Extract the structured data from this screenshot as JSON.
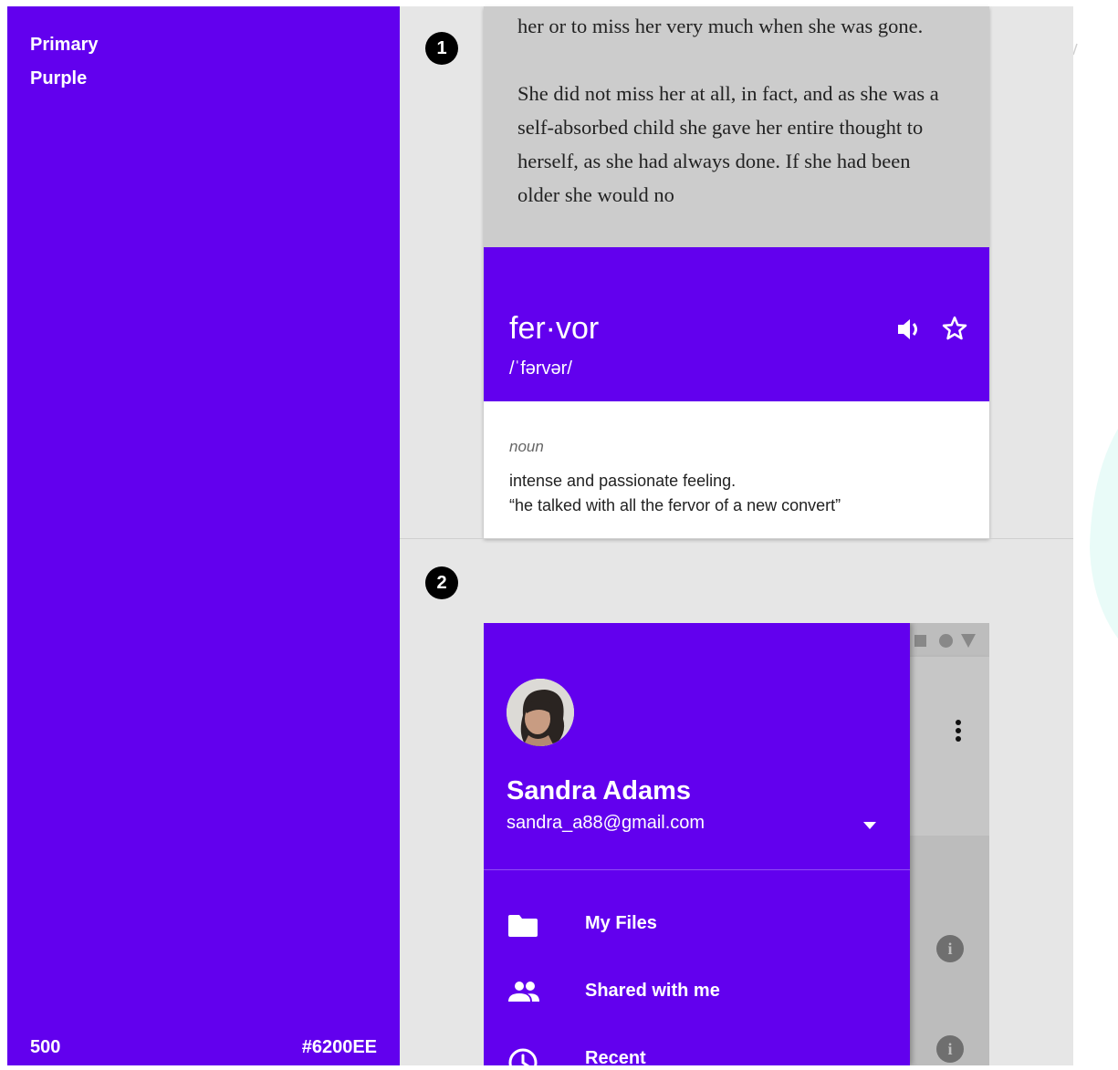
{
  "swatch": {
    "name_line1": "Primary",
    "name_line2": "Purple",
    "weight": "500",
    "hex": "#6200EE",
    "color": "#6200EE"
  },
  "markers": [
    "1",
    "2"
  ],
  "reader": {
    "paragraphs": [
      "her or to miss her very much when she was gone.",
      "She did not miss her at all, in fact, and as she was a self-absorbed child she gave her entire thought to herself, as she had always done. If she had been older she would no"
    ]
  },
  "dictionary": {
    "word": "fer·vor",
    "pronunciation": "/ˈfərvər/",
    "part_of_speech": "noun",
    "definition": "intense and passionate feeling.",
    "example": "“he talked with all the fervor of a new convert”",
    "icons": [
      "volume-icon",
      "star-outline-icon"
    ]
  },
  "drawer": {
    "name": "Sandra Adams",
    "email": "sandra_a88@gmail.com",
    "items": [
      {
        "label": "My Files",
        "icon": "folder-icon"
      },
      {
        "label": "Shared with me",
        "icon": "people-icon"
      },
      {
        "label": "Recent",
        "icon": "clock-icon"
      }
    ]
  },
  "colors": {
    "primary": "#6200EE",
    "panel_bg": "#e6e6e6",
    "reader_bg": "#cccccc",
    "card_bg": "#ffffff"
  }
}
